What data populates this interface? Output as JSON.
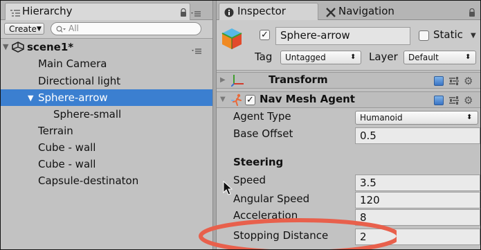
{
  "hierarchy": {
    "tab_title": "Hierarchy",
    "create_label": "Create",
    "search_placeholder": "All",
    "scene_name": "scene1*",
    "items": [
      {
        "label": "Main Camera"
      },
      {
        "label": "Directional light"
      },
      {
        "label": "Sphere-arrow",
        "selected": true,
        "expanded": true
      },
      {
        "label": "Sphere-small",
        "child": true
      },
      {
        "label": "Terrain"
      },
      {
        "label": "Cube - wall"
      },
      {
        "label": "Cube - wall"
      },
      {
        "label": "Capsule-destinaton"
      }
    ]
  },
  "inspector": {
    "tab_title": "Inspector",
    "nav_tab_title": "Navigation",
    "object_name": "Sphere-arrow",
    "static_label": "Static",
    "tag_label": "Tag",
    "tag_value": "Untagged",
    "layer_label": "Layer",
    "layer_value": "Default",
    "transform_label": "Transform",
    "navmesh_label": "Nav Mesh Agent",
    "agent_type_label": "Agent Type",
    "agent_type_value": "Humanoid",
    "base_offset_label": "Base Offset",
    "base_offset_value": "0.5",
    "steering_label": "Steering",
    "speed_label": "Speed",
    "speed_value": "3.5",
    "angular_speed_label": "Angular Speed",
    "angular_speed_value": "120",
    "acceleration_label": "Acceleration",
    "acceleration_value": "8",
    "stopping_distance_label": "Stopping Distance",
    "stopping_distance_value": "2"
  },
  "colors": {
    "selection": "#3b7fd0",
    "highlight_ellipse": "#e8604c"
  },
  "icons": [
    "hierarchy-list-icon",
    "lock-icon",
    "panel-menu-icon",
    "info-icon",
    "navigation-icon",
    "unity-scene-icon",
    "cube-icon",
    "transform-axes-icon",
    "navmesh-agent-icon",
    "help-book-icon",
    "settings-gear-icon",
    "preset-icon",
    "mouse-pointer-icon"
  ]
}
